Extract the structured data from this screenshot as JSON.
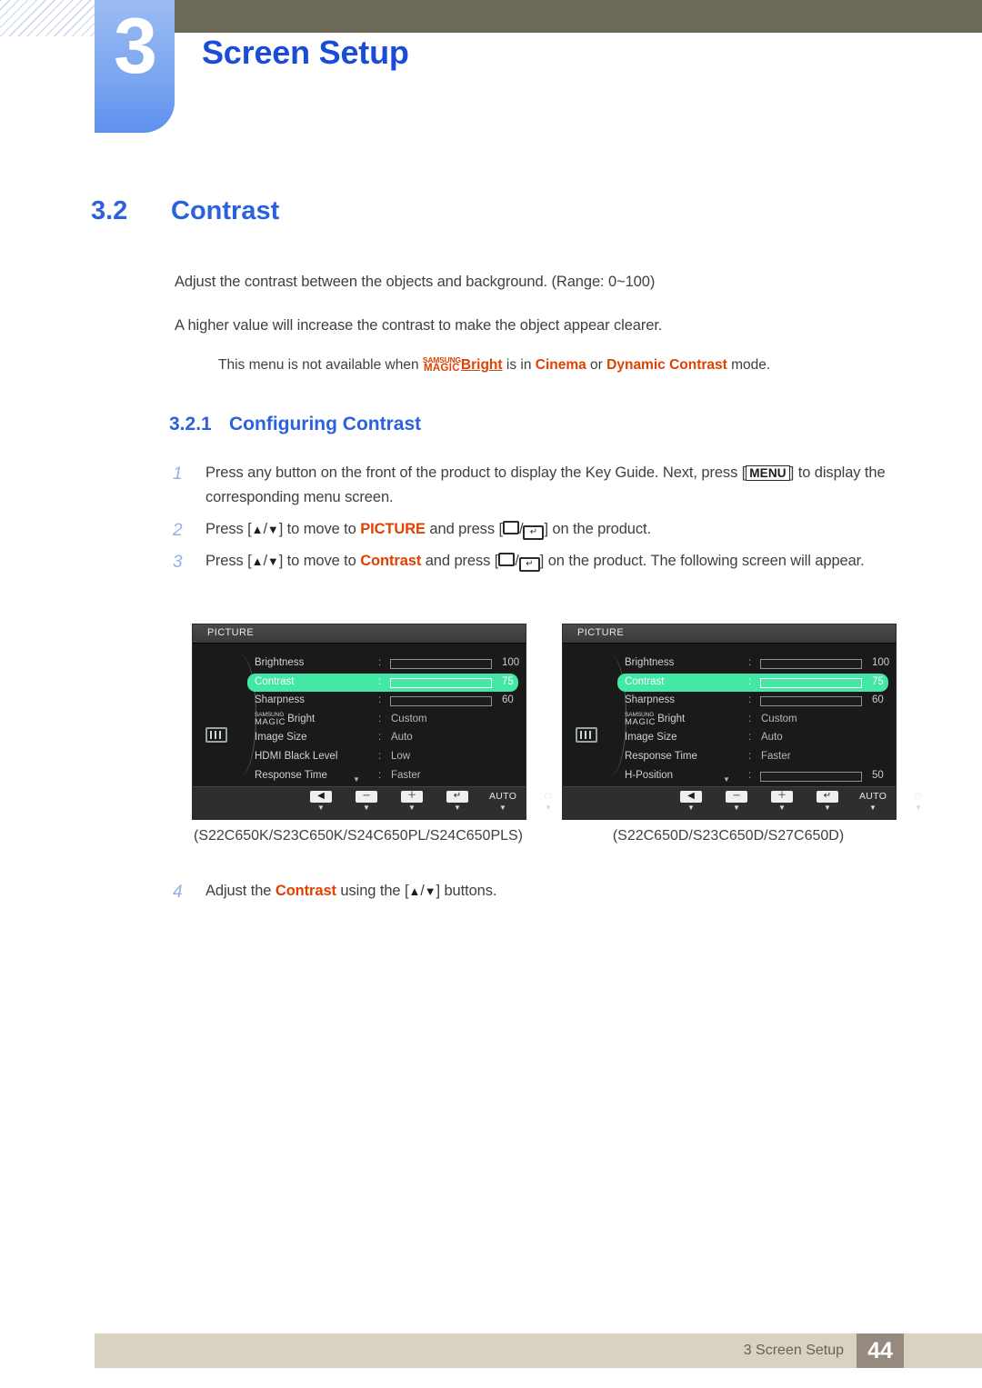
{
  "chapter": {
    "number": "3",
    "title": "Screen Setup"
  },
  "section": {
    "number": "3.2",
    "title": "Contrast"
  },
  "paragraphs": {
    "p1": "Adjust the contrast between the objects and background. (Range: 0~100)",
    "p2": "A higher value will increase the contrast to make the object appear clearer."
  },
  "note": {
    "prefix": "This menu is not available when ",
    "logo_top": "SAMSUNG",
    "logo_bottom": "MAGIC",
    "logo_word": "Bright",
    "mid": " is in ",
    "mode_1": "Cinema",
    "conj": " or ",
    "mode_2": "Dynamic Contrast",
    "suffix": " mode."
  },
  "subsection": {
    "number": "3.2.1",
    "title": "Configuring Contrast"
  },
  "steps": [
    {
      "index": "1",
      "part_a": "Press any button on the front of the product to display the Key Guide. Next, press [",
      "key": "MENU",
      "part_b": "] to display the corresponding menu screen."
    },
    {
      "index": "2",
      "part_a": "Press [",
      "tri_up": "▲",
      "slash": "/",
      "tri_down": "▼",
      "part_b": "] to move to ",
      "target": "PICTURE",
      "part_c": " and press [",
      "part_d": "] on the product."
    },
    {
      "index": "3",
      "part_a": "Press [",
      "tri_up": "▲",
      "slash": "/",
      "tri_down": "▼",
      "part_b": "] to move to ",
      "target": "Contrast",
      "part_c": " and press [",
      "part_d": "] on the product. The following screen will appear."
    },
    {
      "index": "4",
      "part_a": "Adjust the ",
      "target": "Contrast",
      "part_b": " using the [",
      "tri_up": "▲",
      "slash": "/",
      "tri_down": "▼",
      "part_c": "] buttons."
    }
  ],
  "osd_left": {
    "title": "PICTURE",
    "rows": [
      {
        "label": "Brightness",
        "kind": "bar",
        "fill_pct": 100,
        "number": "100",
        "selected": false
      },
      {
        "label": "Contrast",
        "kind": "bar",
        "fill_pct": 75,
        "number": "75",
        "selected": true
      },
      {
        "label": "Sharpness",
        "kind": "bar",
        "fill_pct": 60,
        "number": "60",
        "selected": false
      },
      {
        "label": "MAGICBright",
        "kind": "magic",
        "value": "Custom",
        "selected": false
      },
      {
        "label": "Image Size",
        "kind": "value",
        "value": "Auto",
        "selected": false
      },
      {
        "label": "HDMI Black Level",
        "kind": "value",
        "value": "Low",
        "selected": false
      },
      {
        "label": "Response Time",
        "kind": "value",
        "value": "Faster",
        "selected": false
      }
    ],
    "scroll_arrow": "▼",
    "buttons": [
      {
        "glyph": "◀",
        "type": "box",
        "tick": "▼"
      },
      {
        "glyph": "─",
        "type": "box",
        "tick": "▼"
      },
      {
        "glyph": "＋",
        "type": "box",
        "tick": "▼"
      },
      {
        "glyph": "↵",
        "type": "box",
        "tick": "▼"
      },
      {
        "glyph": "AUTO",
        "type": "text",
        "tick": "▼"
      },
      {
        "glyph": "⏻",
        "type": "text",
        "tick": "▼"
      }
    ]
  },
  "osd_right": {
    "title": "PICTURE",
    "rows": [
      {
        "label": "Brightness",
        "kind": "bar",
        "fill_pct": 100,
        "number": "100",
        "selected": false
      },
      {
        "label": "Contrast",
        "kind": "bar",
        "fill_pct": 75,
        "number": "75",
        "selected": true
      },
      {
        "label": "Sharpness",
        "kind": "bar",
        "fill_pct": 60,
        "number": "60",
        "selected": false
      },
      {
        "label": "MAGICBright",
        "kind": "magic",
        "value": "Custom",
        "selected": false
      },
      {
        "label": "Image Size",
        "kind": "value",
        "value": "Auto",
        "selected": false
      },
      {
        "label": "Response Time",
        "kind": "value",
        "value": "Faster",
        "selected": false
      },
      {
        "label": "H-Position",
        "kind": "bar",
        "fill_pct": 50,
        "number": "50",
        "selected": false
      }
    ],
    "scroll_arrow": "▼",
    "buttons": [
      {
        "glyph": "◀",
        "type": "box",
        "tick": "▼"
      },
      {
        "glyph": "─",
        "type": "box",
        "tick": "▼"
      },
      {
        "glyph": "＋",
        "type": "box",
        "tick": "▼"
      },
      {
        "glyph": "↵",
        "type": "box",
        "tick": "▼"
      },
      {
        "glyph": "AUTO",
        "type": "text",
        "tick": "▼"
      },
      {
        "glyph": "⏻",
        "type": "text",
        "tick": "▼"
      }
    ]
  },
  "captions": {
    "left": "(S22C650K/S23C650K/S24C650PL/S24C650PLS)",
    "right": "(S22C650D/S23C650D/S27C650D)"
  },
  "footer": {
    "label": "3 Screen Setup",
    "page": "44"
  },
  "colors": {
    "heading_blue": "#2b61dd",
    "chapter_blue": "#1a4cd8",
    "accent_orange": "#e04100",
    "olive": "#6d6a57",
    "footer_band": "#d8d3c1",
    "footer_page_box": "#968a7f",
    "osd_highlight": "#44e8a6"
  }
}
